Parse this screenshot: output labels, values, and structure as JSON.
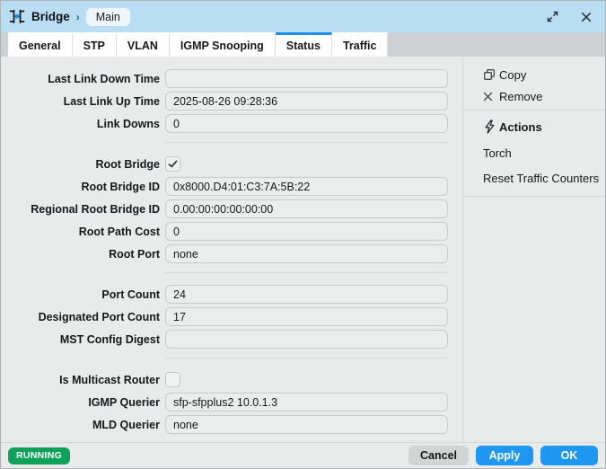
{
  "colors": {
    "titlebar_blue": "#b9ddf3",
    "accent_blue": "#1b90e8",
    "button_blue": "#1e97f2",
    "running_green": "#0fa05a",
    "content_bg": "#e9eaea"
  },
  "window": {
    "icon": "bridge-icon",
    "title": "Bridge",
    "breadcrumb_separator": "›",
    "subtitle": "Main",
    "controls": [
      {
        "name": "maximize-button",
        "icon": "maximize-icon"
      },
      {
        "name": "close-button",
        "icon": "close-icon"
      }
    ]
  },
  "tabs": [
    {
      "label": "General",
      "active": false
    },
    {
      "label": "STP",
      "active": false
    },
    {
      "label": "VLAN",
      "active": false
    },
    {
      "label": "IGMP Snooping",
      "active": false
    },
    {
      "label": "Status",
      "active": true
    },
    {
      "label": "Traffic",
      "active": false
    }
  ],
  "form": {
    "groups": [
      {
        "fields": [
          {
            "label": "Last Link Down Time",
            "type": "text",
            "value": ""
          },
          {
            "label": "Last Link Up Time",
            "type": "text",
            "value": "2025-08-26 09:28:36"
          },
          {
            "label": "Link Downs",
            "type": "text",
            "value": "0"
          }
        ]
      },
      {
        "fields": [
          {
            "label": "Root Bridge",
            "type": "checkbox",
            "checked": true
          },
          {
            "label": "Root Bridge ID",
            "type": "text",
            "value": "0x8000.D4:01:C3:7A:5B:22"
          },
          {
            "label": "Regional Root Bridge ID",
            "type": "text",
            "value": "0.00:00:00:00:00:00"
          },
          {
            "label": "Root Path Cost",
            "type": "text",
            "value": "0"
          },
          {
            "label": "Root Port",
            "type": "text",
            "value": "none"
          }
        ]
      },
      {
        "fields": [
          {
            "label": "Port Count",
            "type": "text",
            "value": "24"
          },
          {
            "label": "Designated Port Count",
            "type": "text",
            "value": "17"
          },
          {
            "label": "MST Config Digest",
            "type": "text",
            "value": ""
          }
        ]
      },
      {
        "fields": [
          {
            "label": "Is Multicast Router",
            "type": "checkbox",
            "checked": false
          },
          {
            "label": "IGMP Querier",
            "type": "text",
            "value": "sfp-sfpplus2 10.0.1.3"
          },
          {
            "label": "MLD Querier",
            "type": "text",
            "value": "none"
          }
        ]
      }
    ]
  },
  "sidebar": {
    "items": [
      {
        "label": "Copy",
        "icon": "copy-icon"
      },
      {
        "label": "Remove",
        "icon": "remove-icon"
      }
    ],
    "actions_header": {
      "label": "Actions",
      "icon": "lightning-bolt-icon"
    },
    "action_items": [
      {
        "label": "Torch"
      },
      {
        "label": "Reset Traffic Counters"
      }
    ]
  },
  "footer": {
    "status_badge": "RUNNING",
    "buttons": [
      {
        "label": "Cancel",
        "style": "gray"
      },
      {
        "label": "Apply",
        "style": "blue"
      },
      {
        "label": "OK",
        "style": "blue"
      }
    ]
  }
}
